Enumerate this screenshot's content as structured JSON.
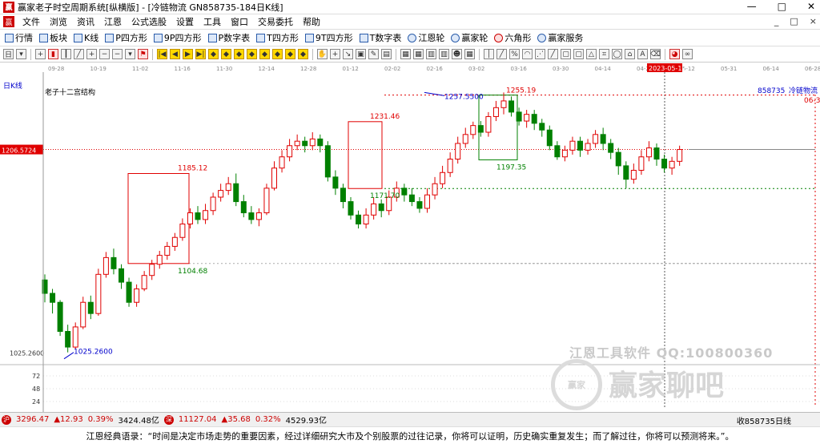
{
  "window": {
    "title": "赢家老子时空周期系统[纵横版] - [冷链物流  GN858735-184日K线]",
    "app_icon": "赢"
  },
  "menu": [
    "文件",
    "浏览",
    "资讯",
    "江恩",
    "公式选股",
    "设置",
    "工具",
    "窗口",
    "交易委托",
    "帮助"
  ],
  "mdi_controls": [
    "_",
    "□",
    "×"
  ],
  "toolbar1": [
    {
      "label": "行情",
      "icon": "grid-icon"
    },
    {
      "label": "板块",
      "icon": "board-icon"
    },
    {
      "label": "K线",
      "icon": "kline-icon"
    },
    {
      "label": "P四方形",
      "icon": "p-square-icon"
    },
    {
      "label": "9P四方形",
      "icon": "9p-square-icon"
    },
    {
      "label": "P数字表",
      "icon": "p-table-icon"
    },
    {
      "label": "T四方形",
      "icon": "t-square-icon"
    },
    {
      "label": "9T四方形",
      "icon": "9t-square-icon"
    },
    {
      "label": "T数字表",
      "icon": "t-table-icon"
    },
    {
      "label": "江恩轮",
      "icon": "gann-wheel-icon"
    },
    {
      "label": "赢家轮",
      "icon": "winner-wheel-icon"
    },
    {
      "label": "六角形",
      "icon": "hexagon-icon"
    },
    {
      "label": "赢家服务",
      "icon": "dollar-icon"
    }
  ],
  "chart": {
    "period_label": "日K线",
    "indicator_label": "老子十二宫结构",
    "code": "858735",
    "name": "冷链物流",
    "right_corner": "06-3",
    "price_marker": "1206.5724",
    "low_label": "1025.2600",
    "low_annot": "1025.2600",
    "high_annot": "1257.5500",
    "date_marker": "2023-05-12",
    "dates": [
      "09-28",
      "10-19",
      "11-02",
      "11-16",
      "11-30",
      "12-14",
      "12-28",
      "01-12",
      "02-02",
      "02-16",
      "03-02",
      "03-16",
      "03-30",
      "04-14",
      "04-28",
      "05-12",
      "05-31",
      "06-14",
      "06-28"
    ],
    "annotations": {
      "a1": "1185.12",
      "a2": "1104.68",
      "a3": "1231.46",
      "a4": "1171.70",
      "a5": "1255.19",
      "a6": "1197.35"
    },
    "volume_ticks": [
      "72",
      "48",
      "24"
    ]
  },
  "chart_data": {
    "type": "candlestick",
    "ylim": [
      1015,
      1270
    ],
    "candles": [
      [
        1090,
        1078,
        1095,
        1070
      ],
      [
        1078,
        1070,
        1082,
        1060
      ],
      [
        1070,
        1044,
        1072,
        1040
      ],
      [
        1044,
        1030,
        1050,
        1025.26
      ],
      [
        1030,
        1048,
        1052,
        1028
      ],
      [
        1048,
        1070,
        1075,
        1046
      ],
      [
        1070,
        1060,
        1076,
        1055
      ],
      [
        1060,
        1095,
        1100,
        1058
      ],
      [
        1095,
        1110,
        1115,
        1092
      ],
      [
        1110,
        1100,
        1118,
        1095
      ],
      [
        1100,
        1088,
        1104,
        1082
      ],
      [
        1088,
        1070,
        1092,
        1066
      ],
      [
        1070,
        1082,
        1086,
        1066
      ],
      [
        1082,
        1094,
        1098,
        1080
      ],
      [
        1094,
        1104,
        1108,
        1090
      ],
      [
        1104,
        1112,
        1116,
        1100
      ],
      [
        1112,
        1120,
        1124,
        1108
      ],
      [
        1120,
        1128,
        1132,
        1116
      ],
      [
        1128,
        1140,
        1145,
        1125
      ],
      [
        1140,
        1150,
        1154,
        1136
      ],
      [
        1150,
        1144,
        1156,
        1140
      ],
      [
        1144,
        1152,
        1158,
        1140
      ],
      [
        1152,
        1164,
        1168,
        1148
      ],
      [
        1164,
        1170,
        1176,
        1160
      ],
      [
        1170,
        1176,
        1182,
        1166
      ],
      [
        1176,
        1160,
        1185.12,
        1156
      ],
      [
        1160,
        1150,
        1166,
        1146
      ],
      [
        1150,
        1144,
        1156,
        1140
      ],
      [
        1144,
        1150,
        1154,
        1138
      ],
      [
        1150,
        1172,
        1176,
        1148
      ],
      [
        1172,
        1190,
        1196,
        1170
      ],
      [
        1190,
        1200,
        1206,
        1186
      ],
      [
        1200,
        1210,
        1216,
        1196
      ],
      [
        1210,
        1214,
        1220,
        1206
      ],
      [
        1214,
        1210,
        1218,
        1204
      ],
      [
        1210,
        1216,
        1222,
        1206
      ],
      [
        1216,
        1210,
        1220,
        1204
      ],
      [
        1210,
        1182,
        1214,
        1178
      ],
      [
        1182,
        1172,
        1188,
        1166
      ],
      [
        1172,
        1160,
        1176,
        1154
      ],
      [
        1160,
        1148,
        1164,
        1144
      ],
      [
        1148,
        1140,
        1152,
        1136
      ],
      [
        1140,
        1148,
        1154,
        1136
      ],
      [
        1148,
        1158,
        1164,
        1144
      ],
      [
        1158,
        1152,
        1162,
        1146
      ],
      [
        1152,
        1164,
        1170,
        1148
      ],
      [
        1164,
        1172,
        1178,
        1160
      ],
      [
        1172,
        1166,
        1176,
        1160
      ],
      [
        1166,
        1160,
        1172,
        1156
      ],
      [
        1160,
        1154,
        1164,
        1150
      ],
      [
        1154,
        1166,
        1172,
        1150
      ],
      [
        1166,
        1176,
        1182,
        1162
      ],
      [
        1176,
        1186,
        1192,
        1172
      ],
      [
        1186,
        1198,
        1204,
        1182
      ],
      [
        1198,
        1212,
        1218,
        1194
      ],
      [
        1212,
        1220,
        1226,
        1208
      ],
      [
        1220,
        1228,
        1231.46,
        1216
      ],
      [
        1228,
        1222,
        1232,
        1218
      ],
      [
        1222,
        1236,
        1240,
        1218
      ],
      [
        1236,
        1244,
        1250,
        1232
      ],
      [
        1244,
        1250,
        1257.55,
        1238
      ],
      [
        1250,
        1240,
        1254,
        1236
      ],
      [
        1240,
        1232,
        1244,
        1228
      ],
      [
        1232,
        1238,
        1242,
        1226
      ],
      [
        1238,
        1230,
        1242,
        1224
      ],
      [
        1230,
        1224,
        1234,
        1218
      ],
      [
        1224,
        1210,
        1228,
        1206
      ],
      [
        1210,
        1200,
        1214,
        1197.35
      ],
      [
        1200,
        1206,
        1210,
        1196
      ],
      [
        1206,
        1214,
        1218,
        1202
      ],
      [
        1214,
        1206,
        1218,
        1200
      ],
      [
        1206,
        1212,
        1216,
        1202
      ],
      [
        1212,
        1220,
        1224,
        1208
      ],
      [
        1220,
        1212,
        1226,
        1206
      ],
      [
        1212,
        1204,
        1216,
        1198
      ],
      [
        1204,
        1192,
        1208,
        1184
      ],
      [
        1192,
        1180,
        1196,
        1172
      ],
      [
        1180,
        1188,
        1194,
        1176
      ],
      [
        1188,
        1200,
        1206,
        1184
      ],
      [
        1200,
        1208,
        1214,
        1196
      ],
      [
        1208,
        1198,
        1212,
        1192
      ],
      [
        1198,
        1190,
        1202,
        1186
      ],
      [
        1190,
        1196,
        1200,
        1184
      ],
      [
        1196,
        1206.57,
        1210,
        1192
      ]
    ]
  },
  "status": {
    "sh_index": "3296.47",
    "sh_change": "▲12.93",
    "sh_pct": "0.39%",
    "sh_amount": "3424.48亿",
    "sz_index": "11127.04",
    "sz_change": "▲35.68",
    "sz_pct": "0.32%",
    "sz_amount": "4529.93亿",
    "right": "收858735日线"
  },
  "quote": "江恩经典语录：“时间是决定市场走势的重要因素，经过详细研究大市及个别股票的过往记录，你将可以证明，历史确实重复发生；而了解过往，你将可以预测将来。”。",
  "watermark": {
    "line1": "江恩工具软件  QQ:100800360",
    "line2": "赢家聊吧",
    "seal": "赢家"
  },
  "colors": {
    "up": "#e00000",
    "down": "#008000",
    "accent_blue": "#0000cc",
    "price_marker_bg": "#e00000"
  }
}
